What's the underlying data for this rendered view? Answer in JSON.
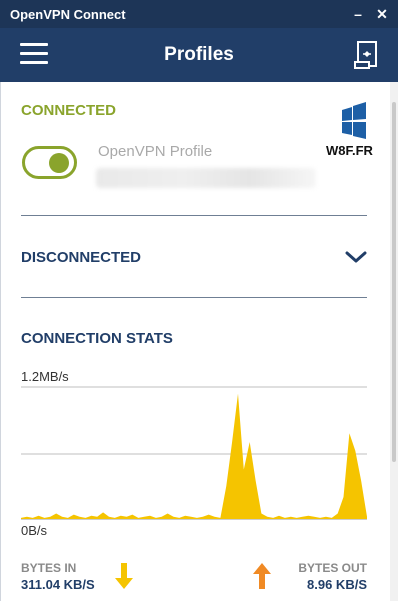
{
  "window": {
    "title": "OpenVPN Connect",
    "minimize_glyph": "–",
    "close_glyph": "✕"
  },
  "header": {
    "title": "Profiles",
    "menu_icon": "hamburger-menu-icon",
    "import_icon": "import-profile-icon"
  },
  "connected_section": {
    "status": "CONNECTED",
    "profile_name": "OpenVPN Profile",
    "toggle_on": true,
    "accent": "#8aa42c"
  },
  "watermark": {
    "text": "W8F.FR"
  },
  "disconnected_section": {
    "status": "DISCONNECTED",
    "expand_icon": "chevron-down-icon"
  },
  "stats": {
    "title": "CONNECTION STATS",
    "max_label": "1.2MB/s",
    "min_label": "0B/s",
    "bytes_in": {
      "label": "BYTES IN",
      "value": "311.04 KB/S",
      "color": "#f5c400"
    },
    "bytes_out": {
      "label": "BYTES OUT",
      "value": "8.96 KB/S",
      "color": "#f08a24"
    }
  },
  "chart_data": {
    "type": "area",
    "ylim": [
      0,
      1.2
    ],
    "yticks": [
      "1.2MB/s",
      "0B/s"
    ],
    "series": [
      {
        "color": "#f5c400",
        "values": [
          0.01,
          0.02,
          0.01,
          0.03,
          0.01,
          0.02,
          0.05,
          0.02,
          0.01,
          0.04,
          0.02,
          0.01,
          0.03,
          0.02,
          0.06,
          0.02,
          0.01,
          0.03,
          0.02,
          0.04,
          0.01,
          0.02,
          0.03,
          0.01,
          0.02,
          0.05,
          0.02,
          0.01,
          0.03,
          0.02,
          0.01,
          0.02,
          0.04,
          0.02,
          0.01,
          0.3,
          0.7,
          1.14,
          0.45,
          0.7,
          0.35,
          0.05,
          0.02,
          0.01,
          0.03,
          0.01,
          0.02,
          0.01,
          0.02,
          0.03,
          0.02,
          0.01,
          0.02,
          0.01,
          0.05,
          0.2,
          0.78,
          0.62,
          0.35,
          0.02
        ]
      }
    ]
  }
}
